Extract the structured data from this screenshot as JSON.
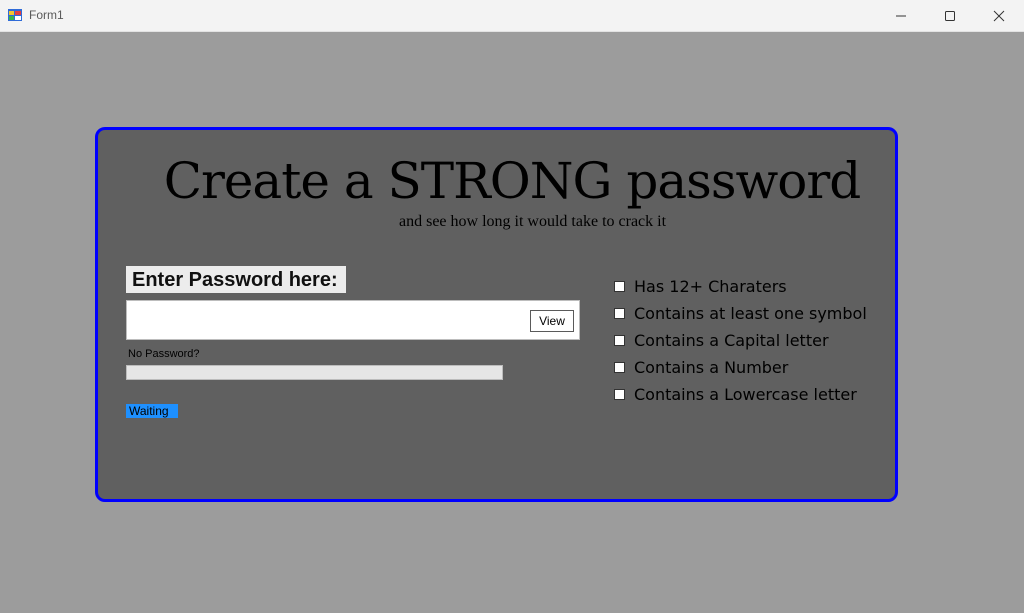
{
  "window": {
    "title": "Form1"
  },
  "header": {
    "title": "Create a STRONG password",
    "subtitle": "and see how long it would take to crack it"
  },
  "password": {
    "label": "Enter Password here:",
    "value": "",
    "view_label": "View",
    "hint": "No Password?",
    "strength_progress": 0,
    "status": "Waiting"
  },
  "checklist": [
    {
      "label": "Has 12+ Charaters",
      "checked": false
    },
    {
      "label": "Contains at least one symbol",
      "checked": false
    },
    {
      "label": "Contains a Capital letter",
      "checked": false
    },
    {
      "label": "Contains a Number",
      "checked": false
    },
    {
      "label": "Contains a Lowercase letter",
      "checked": false
    }
  ],
  "colors": {
    "panel": "#606060",
    "panel_border": "#0000ff",
    "status_bg": "#1e90ff",
    "background": "#9c9c9c"
  }
}
